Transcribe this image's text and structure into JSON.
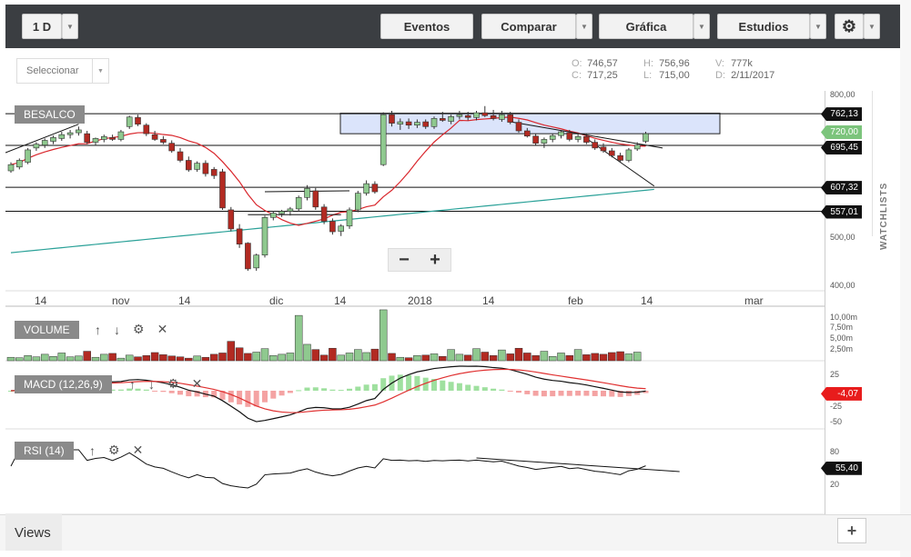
{
  "toolbar": {
    "interval": "1 D",
    "eventos": "Eventos",
    "comparar": "Comparar",
    "grafica": "Gráfica",
    "estudios": "Estudios"
  },
  "selector": {
    "label": "Seleccionar"
  },
  "ohlc": {
    "o_label": "O:",
    "o": "746,57",
    "c_label": "C:",
    "c": "717,25",
    "h_label": "H:",
    "h": "756,96",
    "l_label": "L:",
    "l": "715,00",
    "v_label": "V:",
    "v": "777k",
    "d_label": "D:",
    "d": "2/11/2017"
  },
  "symbol": "BESALCO",
  "price_axis": {
    "ticks": [
      "800,00",
      "500,00",
      "400,00"
    ],
    "labels": [
      {
        "value": "762,13",
        "color": "#111111"
      },
      {
        "value": "720,00",
        "color": "#7cc47c"
      },
      {
        "value": "695,45",
        "color": "#111111"
      },
      {
        "value": "607,32",
        "color": "#111111"
      },
      {
        "value": "557,01",
        "color": "#111111"
      }
    ]
  },
  "xaxis": [
    "14",
    "nov",
    "14",
    "dic",
    "14",
    "2018",
    "14",
    "feb",
    "14",
    "mar"
  ],
  "zoom": {
    "minus": "−",
    "plus": "+"
  },
  "watchlists": "WATCHLISTS",
  "volume": {
    "label": "VOLUME",
    "ticks": [
      "10,00m",
      "7,50m",
      "5,00m",
      "2,50m"
    ]
  },
  "macd": {
    "label": "MACD (12,26,9)",
    "ticks": [
      "25",
      "-25",
      "-50"
    ],
    "value": "-4,07"
  },
  "rsi": {
    "label": "RSI (14)",
    "ticks": [
      "80",
      "20"
    ],
    "value": "55,40"
  },
  "footer": {
    "views": "Views",
    "add": "+"
  },
  "colors": {
    "up": "#8fc98f",
    "down": "#b22a22",
    "sma": "#d9262c",
    "sma_long": "#2aa198",
    "rectangle": "#dbe4fb"
  },
  "chart_data": {
    "type": "candlestick",
    "symbol": "BESALCO",
    "ylim": [
      390,
      810
    ],
    "horizontal_lines": [
      762.13,
      695.45,
      607.32,
      557.01
    ],
    "last_price": 720.0,
    "candles": [
      {
        "o": 642,
        "h": 660,
        "l": 638,
        "c": 655
      },
      {
        "o": 650,
        "h": 668,
        "l": 645,
        "c": 664
      },
      {
        "o": 660,
        "h": 690,
        "l": 656,
        "c": 686
      },
      {
        "o": 690,
        "h": 702,
        "l": 684,
        "c": 698
      },
      {
        "o": 696,
        "h": 710,
        "l": 690,
        "c": 706
      },
      {
        "o": 704,
        "h": 716,
        "l": 698,
        "c": 712
      },
      {
        "o": 710,
        "h": 724,
        "l": 705,
        "c": 718
      },
      {
        "o": 718,
        "h": 728,
        "l": 710,
        "c": 722
      },
      {
        "o": 722,
        "h": 735,
        "l": 716,
        "c": 728
      },
      {
        "o": 720,
        "h": 726,
        "l": 698,
        "c": 702
      },
      {
        "o": 702,
        "h": 712,
        "l": 695,
        "c": 710
      },
      {
        "o": 708,
        "h": 718,
        "l": 702,
        "c": 714
      },
      {
        "o": 712,
        "h": 718,
        "l": 705,
        "c": 708
      },
      {
        "o": 708,
        "h": 728,
        "l": 704,
        "c": 724
      },
      {
        "o": 735,
        "h": 758,
        "l": 730,
        "c": 755
      },
      {
        "o": 754,
        "h": 760,
        "l": 736,
        "c": 740
      },
      {
        "o": 738,
        "h": 742,
        "l": 715,
        "c": 720
      },
      {
        "o": 718,
        "h": 726,
        "l": 705,
        "c": 708
      },
      {
        "o": 708,
        "h": 715,
        "l": 698,
        "c": 702
      },
      {
        "o": 700,
        "h": 706,
        "l": 680,
        "c": 684
      },
      {
        "o": 682,
        "h": 690,
        "l": 660,
        "c": 664
      },
      {
        "o": 664,
        "h": 672,
        "l": 640,
        "c": 644
      },
      {
        "o": 645,
        "h": 662,
        "l": 640,
        "c": 658
      },
      {
        "o": 658,
        "h": 664,
        "l": 630,
        "c": 636
      },
      {
        "o": 645,
        "h": 650,
        "l": 625,
        "c": 632
      },
      {
        "o": 640,
        "h": 646,
        "l": 560,
        "c": 564
      },
      {
        "o": 560,
        "h": 566,
        "l": 515,
        "c": 520
      },
      {
        "o": 520,
        "h": 530,
        "l": 480,
        "c": 488
      },
      {
        "o": 490,
        "h": 492,
        "l": 432,
        "c": 436
      },
      {
        "o": 438,
        "h": 468,
        "l": 432,
        "c": 465
      },
      {
        "o": 465,
        "h": 548,
        "l": 460,
        "c": 544
      },
      {
        "o": 544,
        "h": 558,
        "l": 538,
        "c": 553
      },
      {
        "o": 552,
        "h": 560,
        "l": 545,
        "c": 557
      },
      {
        "o": 557,
        "h": 566,
        "l": 548,
        "c": 562
      },
      {
        "o": 562,
        "h": 590,
        "l": 556,
        "c": 586
      },
      {
        "o": 586,
        "h": 612,
        "l": 580,
        "c": 605
      },
      {
        "o": 600,
        "h": 606,
        "l": 560,
        "c": 566
      },
      {
        "o": 566,
        "h": 572,
        "l": 530,
        "c": 536
      },
      {
        "o": 536,
        "h": 542,
        "l": 508,
        "c": 514
      },
      {
        "o": 515,
        "h": 530,
        "l": 505,
        "c": 526
      },
      {
        "o": 526,
        "h": 565,
        "l": 520,
        "c": 560
      },
      {
        "o": 560,
        "h": 600,
        "l": 555,
        "c": 595
      },
      {
        "o": 595,
        "h": 622,
        "l": 590,
        "c": 615
      },
      {
        "o": 614,
        "h": 620,
        "l": 594,
        "c": 598
      },
      {
        "o": 655,
        "h": 765,
        "l": 652,
        "c": 760
      },
      {
        "o": 760,
        "h": 768,
        "l": 735,
        "c": 742
      },
      {
        "o": 740,
        "h": 752,
        "l": 728,
        "c": 745
      },
      {
        "o": 745,
        "h": 752,
        "l": 730,
        "c": 738
      },
      {
        "o": 738,
        "h": 750,
        "l": 732,
        "c": 744
      },
      {
        "o": 745,
        "h": 750,
        "l": 730,
        "c": 735
      },
      {
        "o": 735,
        "h": 756,
        "l": 730,
        "c": 752
      },
      {
        "o": 752,
        "h": 766,
        "l": 745,
        "c": 748
      },
      {
        "o": 746,
        "h": 760,
        "l": 740,
        "c": 756
      },
      {
        "o": 756,
        "h": 768,
        "l": 750,
        "c": 760
      },
      {
        "o": 758,
        "h": 766,
        "l": 748,
        "c": 754
      },
      {
        "o": 754,
        "h": 768,
        "l": 748,
        "c": 764
      },
      {
        "o": 764,
        "h": 778,
        "l": 755,
        "c": 758
      },
      {
        "o": 758,
        "h": 770,
        "l": 748,
        "c": 752
      },
      {
        "o": 750,
        "h": 768,
        "l": 745,
        "c": 760
      },
      {
        "o": 760,
        "h": 766,
        "l": 740,
        "c": 744
      },
      {
        "o": 744,
        "h": 750,
        "l": 722,
        "c": 726
      },
      {
        "o": 726,
        "h": 732,
        "l": 712,
        "c": 715
      },
      {
        "o": 715,
        "h": 720,
        "l": 696,
        "c": 700
      },
      {
        "o": 700,
        "h": 712,
        "l": 690,
        "c": 708
      },
      {
        "o": 708,
        "h": 720,
        "l": 702,
        "c": 716
      },
      {
        "o": 716,
        "h": 728,
        "l": 710,
        "c": 724
      },
      {
        "o": 722,
        "h": 728,
        "l": 704,
        "c": 708
      },
      {
        "o": 708,
        "h": 720,
        "l": 702,
        "c": 714
      },
      {
        "o": 714,
        "h": 720,
        "l": 698,
        "c": 702
      },
      {
        "o": 702,
        "h": 708,
        "l": 686,
        "c": 690
      },
      {
        "o": 692,
        "h": 700,
        "l": 680,
        "c": 684
      },
      {
        "o": 684,
        "h": 690,
        "l": 670,
        "c": 674
      },
      {
        "o": 674,
        "h": 680,
        "l": 660,
        "c": 664
      },
      {
        "o": 664,
        "h": 690,
        "l": 660,
        "c": 686
      },
      {
        "o": 688,
        "h": 702,
        "l": 684,
        "c": 696
      },
      {
        "o": 704,
        "h": 724,
        "l": 700,
        "c": 720
      }
    ],
    "volume_ylim": [
      0,
      12
    ],
    "volume_m": [
      0.8,
      0.7,
      1.2,
      0.9,
      1.5,
      1.0,
      1.8,
      0.9,
      1.1,
      2.2,
      0.8,
      1.5,
      1.7,
      0.6,
      1.3,
      0.9,
      1.2,
      1.9,
      1.4,
      1.1,
      0.9,
      0.6,
      1.1,
      0.8,
      1.5,
      1.8,
      4.5,
      3.0,
      1.7,
      2.0,
      2.8,
      1.2,
      1.5,
      1.8,
      10.5,
      3.8,
      2.6,
      1.3,
      2.9,
      1.3,
      1.8,
      2.6,
      1.9,
      2.7,
      11.8,
      1.7,
      0.8,
      0.7,
      1.2,
      1.3,
      1.6,
      1.0,
      2.6,
      1.5,
      1.3,
      2.8,
      2.0,
      1.2,
      2.5,
      1.6,
      2.9,
      1.8,
      1.2,
      2.2,
      1.0,
      1.8,
      1.2,
      2.6,
      1.4,
      1.7,
      1.5,
      1.9,
      2.1,
      1.6,
      2.0
    ],
    "macd_ylim": [
      -60,
      40
    ],
    "rsi_ylim": [
      0,
      100
    ]
  }
}
